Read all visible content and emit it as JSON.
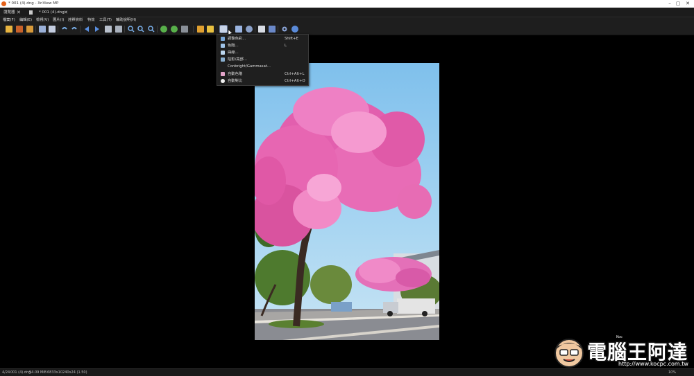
{
  "window": {
    "title": "* 001 (4).dng - XnView MP"
  },
  "tabs": [
    {
      "label": "瀏覽器"
    },
    {
      "label": "* 001 (4).dng"
    }
  ],
  "menu": [
    "檔案(F)",
    "編輯(E)",
    "檢視(V)",
    "圖片(I)",
    "詮釋資料",
    "特效",
    "工具(T)",
    "輔助說明(H)"
  ],
  "toolbar_icons": [
    "open-folder-icon",
    "browse-icon",
    "fullscreen-icon",
    "save-icon",
    "save-as-icon",
    "undo-icon",
    "redo-icon",
    "previous-icon",
    "next-icon",
    "zoom-fit-icon",
    "zoom-actual-icon",
    "zoom-in-icon",
    "zoom-out-icon",
    "zoom-icon",
    "rotate-left-icon",
    "rotate-right-icon",
    "crop-icon",
    "resize-icon",
    "adjust-icon",
    "color-adjust-icon",
    "effects-icon",
    "filter-icon",
    "print-icon",
    "scan-icon",
    "settings-icon",
    "help-icon"
  ],
  "dropdown": {
    "items": [
      {
        "label": "調整色彩...",
        "shortcut": "Shift+E",
        "icon": "color-balance-icon",
        "color": "#7aa7d8"
      },
      {
        "label": "色階...",
        "shortcut": "L",
        "icon": "levels-icon",
        "color": "#a0c4e8"
      },
      {
        "label": "曲線...",
        "shortcut": "",
        "icon": "curves-icon",
        "color": "#bcd6ee"
      },
      {
        "label": "陰影/亮部...",
        "shortcut": "",
        "icon": "shadow-highlight-icon",
        "color": "#8ab0d0"
      },
      {
        "label": "Conbright/Gammasat...",
        "shortcut": "",
        "icon": "",
        "color": ""
      },
      {
        "label": "自動色階",
        "shortcut": "Ctrl+Alt+L",
        "icon": "auto-levels-icon",
        "color": "#e2a3c8"
      },
      {
        "label": "自動對比",
        "shortcut": "Ctrl+Alt+O",
        "icon": "auto-contrast-icon",
        "color": "#f0f0f0"
      }
    ]
  },
  "status": {
    "index": "4/24",
    "filename": "001 (4).dng",
    "filesize": "54.09 MiB",
    "dimensions": "6833x10240x24 (1.50)",
    "zoom": "10%"
  },
  "watermark": {
    "text": "電腦王阿達",
    "url": "http://www.kocpc.com.tw",
    "tag": "Koc"
  }
}
